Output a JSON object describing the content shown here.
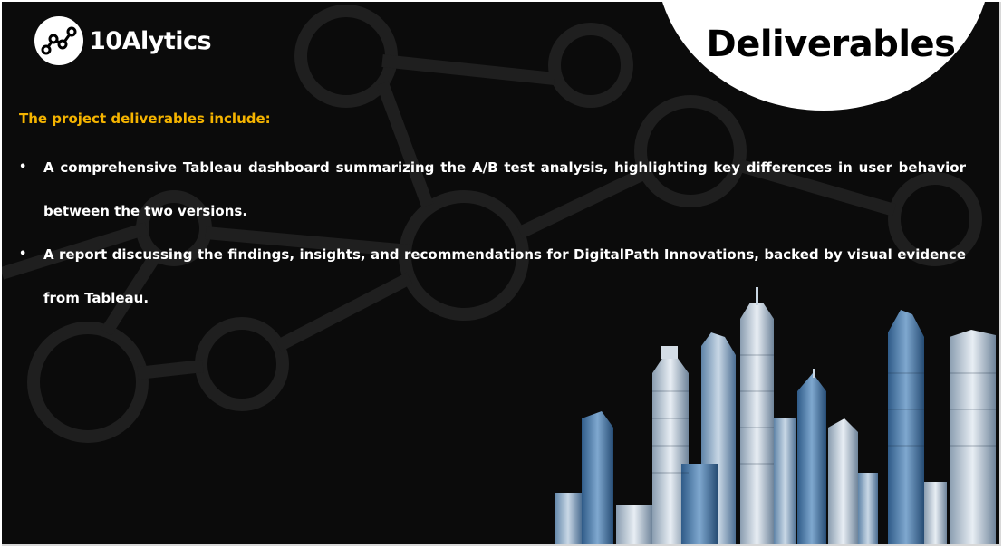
{
  "brand": {
    "logo_text": "10Alytics"
  },
  "slide": {
    "title": "Deliverables",
    "intro": "The project deliverables include:",
    "bullets": [
      {
        "marker": "•",
        "text": "A comprehensive Tableau dashboard summarizing the A/B test analysis, highlighting key differences in user behavior between the two versions."
      },
      {
        "marker": "•",
        "text": "A report discussing the findings, insights, and recommendations for DigitalPath Innovations, backed by visual evidence from Tableau."
      }
    ]
  },
  "colors": {
    "background": "#0b0b0b",
    "accent": "#f5b400",
    "text": "#ffffff",
    "title_bg": "#ffffff"
  },
  "icons": {
    "logo": "network-nodes-icon",
    "decoration": "skyline-illustration"
  }
}
